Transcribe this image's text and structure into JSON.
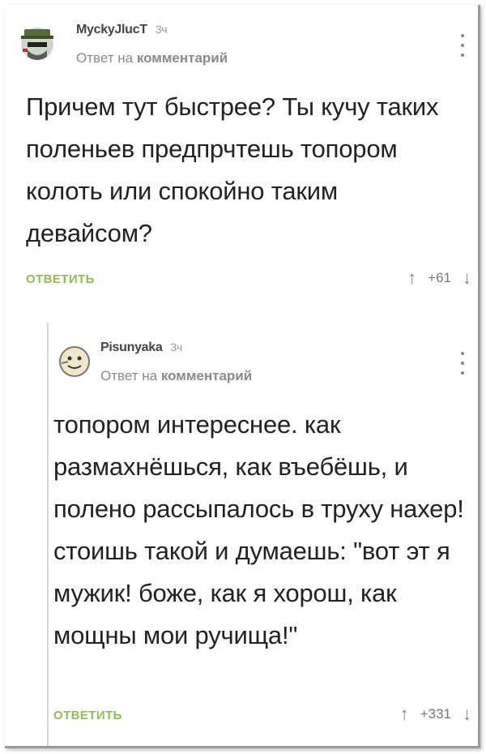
{
  "comments": [
    {
      "username": "MyckyJlucT",
      "time": "3ч",
      "reply_prefix": "Ответ на",
      "reply_target": "комментарий",
      "text": "Причем тут быстрее? Ты кучу таких поленьев предпрчтешь топором колоть или спокойно таким девайсом?",
      "reply_label": "ОТВЕТИТЬ",
      "rating": "+61",
      "up_icon": "arrow-up-icon",
      "down_icon": "arrow-down-icon"
    },
    {
      "username": "Pisunyaka",
      "time": "3ч",
      "reply_prefix": "Ответ на",
      "reply_target": "комментарий",
      "text": "топором интереснее. как размахнёшься, как въебёшь, и полено рассыпалось в труху нахер! стоишь такой и думаешь: \"вот эт я мужик! боже, как я хорош, как мощны мои ручища!\"",
      "reply_label": "ОТВЕТИТЬ",
      "rating": "+331",
      "up_icon": "arrow-up-icon",
      "down_icon": "arrow-down-icon"
    }
  ],
  "colors": {
    "accent_green": "#8fbf4a",
    "muted_gray": "#8a8a8a"
  }
}
